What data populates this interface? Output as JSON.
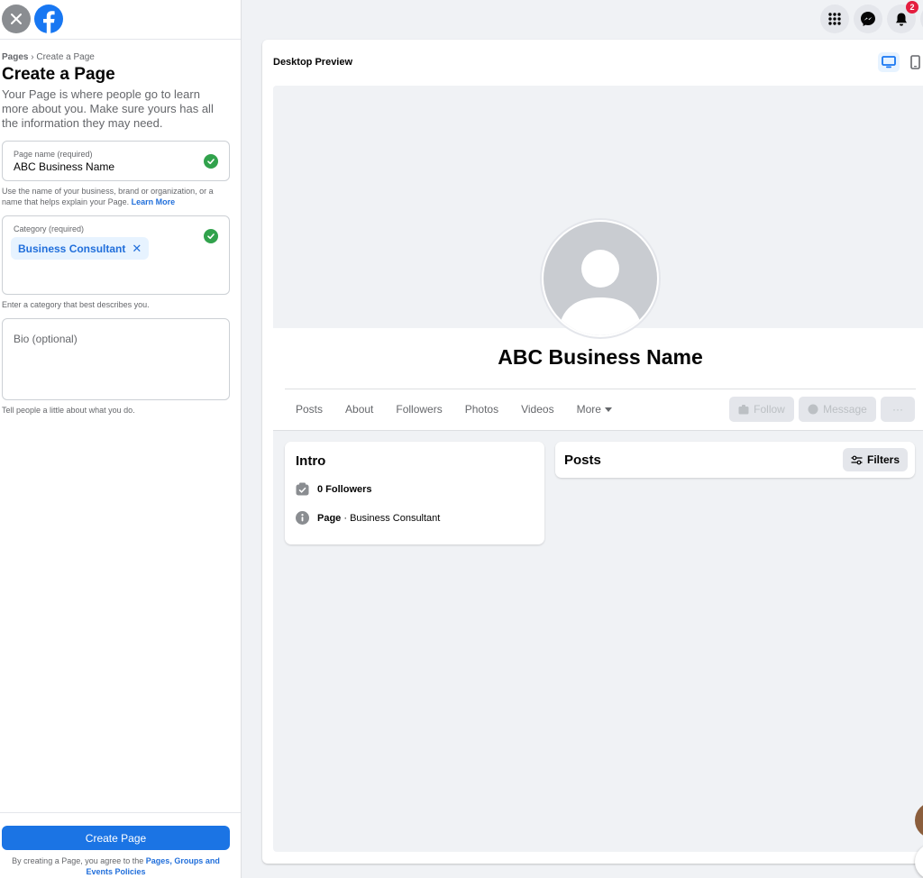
{
  "sidebar": {
    "breadcrumb_root": "Pages",
    "breadcrumb_current": "Create a Page",
    "title": "Create a Page",
    "description": "Your Page is where people go to learn more about you. Make sure yours has all the information they may need.",
    "page_name": {
      "label": "Page name (required)",
      "value": "ABC Business Name",
      "help": "Use the name of your business, brand or organization, or a name that helps explain your Page.",
      "help_link": "Learn More"
    },
    "category": {
      "label": "Category (required)",
      "chip": "Business Consultant",
      "help": "Enter a category that best describes you."
    },
    "bio": {
      "placeholder": "Bio (optional)",
      "help": "Tell people a little about what you do."
    },
    "create_button": "Create Page",
    "terms_prefix": "By creating a Page, you agree to the",
    "terms_link": "Pages, Groups and Events Policies"
  },
  "header": {
    "notifications_count": "2"
  },
  "preview": {
    "title": "Desktop Preview",
    "page_name": "ABC Business Name",
    "tabs": [
      "Posts",
      "About",
      "Followers",
      "Photos",
      "Videos",
      "More"
    ],
    "follow_button": "Follow",
    "message_button": "Message",
    "more_button": "···",
    "intro": {
      "heading": "Intro",
      "followers": "0 Followers",
      "page_type_label": "Page",
      "page_type_value": " · Business Consultant"
    },
    "posts": {
      "heading": "Posts",
      "filters_button": "Filters"
    }
  },
  "colors": {
    "accent": "#1b74e4",
    "success": "#31a24c",
    "badge": "#e41e3f"
  }
}
